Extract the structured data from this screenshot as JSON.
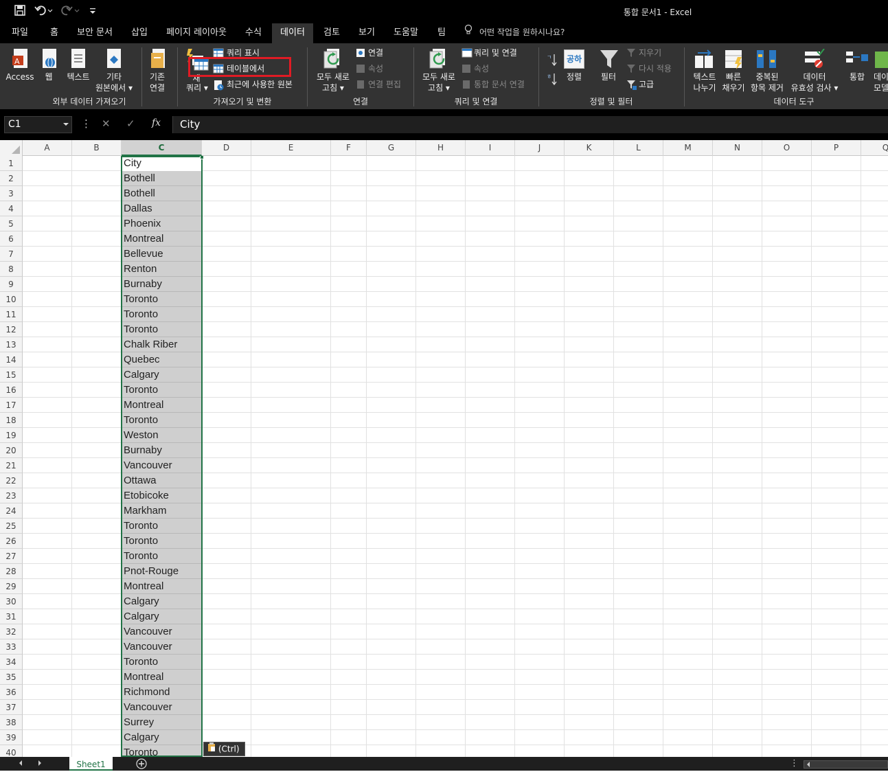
{
  "app": {
    "title": "통합 문서1  -  Excel",
    "quick_access": [
      "save-icon",
      "undo-icon",
      "redo-icon",
      "customize-icon"
    ]
  },
  "tabs": [
    "파일",
    "홈",
    "보안 문서",
    "삽입",
    "페이지 레이아웃",
    "수식",
    "데이터",
    "검토",
    "보기",
    "도움말",
    "팀"
  ],
  "active_tab": "데이터",
  "tell_me": "어떤 작업을 원하시나요?",
  "ribbon": {
    "external": {
      "access": "Access",
      "web": "웹",
      "text": "텍스트",
      "other_1": "기타",
      "other_2": "원본에서 ▾",
      "label": "외부 데이터 가져오기"
    },
    "existing": {
      "line1": "기존",
      "line2": "연결"
    },
    "get_transform": {
      "new_query_1": "새",
      "new_query_2": "쿼리 ▾",
      "show_queries": "쿼리 표시",
      "from_table": "테이블에서",
      "recent_sources": "최근에 사용한 원본",
      "label": "가져오기 및 변환"
    },
    "connections": {
      "refresh_1": "모두 새로",
      "refresh_2": "고침 ▾",
      "connections": "연결",
      "properties": "속성",
      "edit_links": "연결 편집",
      "label": "연결"
    },
    "queries": {
      "refresh_1": "모두 새로",
      "refresh_2": "고침 ▾",
      "queries_conn": "쿼리 및 연결",
      "properties": "속성",
      "edit_links": "통합 문서 연결",
      "label": "쿼리 및 연결"
    },
    "sort_filter": {
      "sort": "정렬",
      "sort_icon_text": "공하",
      "filter": "필터",
      "clear": "지우기",
      "reapply": "다시 적용",
      "advanced": "고급",
      "label": "정렬 및 필터"
    },
    "data_tools": {
      "text_to_col_1": "텍스트",
      "text_to_col_2": "나누기",
      "flash_fill_1": "빠른",
      "flash_fill_2": "채우기",
      "remove_dup_1": "중복된",
      "remove_dup_2": "항목 제거",
      "validation_1": "데이터",
      "validation_2": "유효성 검사 ▾",
      "consolidate": "통합",
      "model_1": "데이",
      "model_2": "모델",
      "label": "데이터 도구"
    }
  },
  "formula_bar": {
    "name_box": "C1",
    "fx": "fx",
    "formula": "City"
  },
  "columns": [
    "A",
    "B",
    "C",
    "D",
    "E",
    "F",
    "G",
    "H",
    "I",
    "J",
    "K",
    "L",
    "M",
    "N",
    "O",
    "P",
    "Q"
  ],
  "selected_column": "C",
  "rows": [
    "1",
    "2",
    "3",
    "4",
    "5",
    "6",
    "7",
    "8",
    "9",
    "10",
    "11",
    "12",
    "13",
    "14",
    "15",
    "16",
    "17",
    "18",
    "19",
    "20",
    "21",
    "22",
    "23",
    "24",
    "25",
    "26",
    "27",
    "28",
    "29",
    "30",
    "31",
    "32",
    "33",
    "34",
    "35",
    "36",
    "37",
    "38",
    "39",
    "40"
  ],
  "column_c": [
    "City",
    "Bothell",
    "Bothell",
    "Dallas",
    "Phoenix",
    "Montreal",
    "Bellevue",
    "Renton",
    "Burnaby",
    "Toronto",
    "Toronto",
    "Toronto",
    "Chalk Riber",
    "Quebec",
    "Calgary",
    "Toronto",
    "Montreal",
    "Toronto",
    "Weston",
    "Burnaby",
    "Vancouver",
    "Ottawa",
    "Etobicoke",
    "Markham",
    "Toronto",
    "Toronto",
    "Toronto",
    "Pnot-Rouge",
    "Montreal",
    "Calgary",
    "Calgary",
    "Vancouver",
    "Vancouver",
    "Toronto",
    "Montreal",
    "Richmond",
    "Vancouver",
    "Surrey",
    "Calgary",
    "Toronto"
  ],
  "paste_options": "(Ctrl) ▾",
  "sheets": [
    "Sheet1"
  ],
  "colors": {
    "accent": "#217346",
    "highlight": "#e01b24"
  }
}
